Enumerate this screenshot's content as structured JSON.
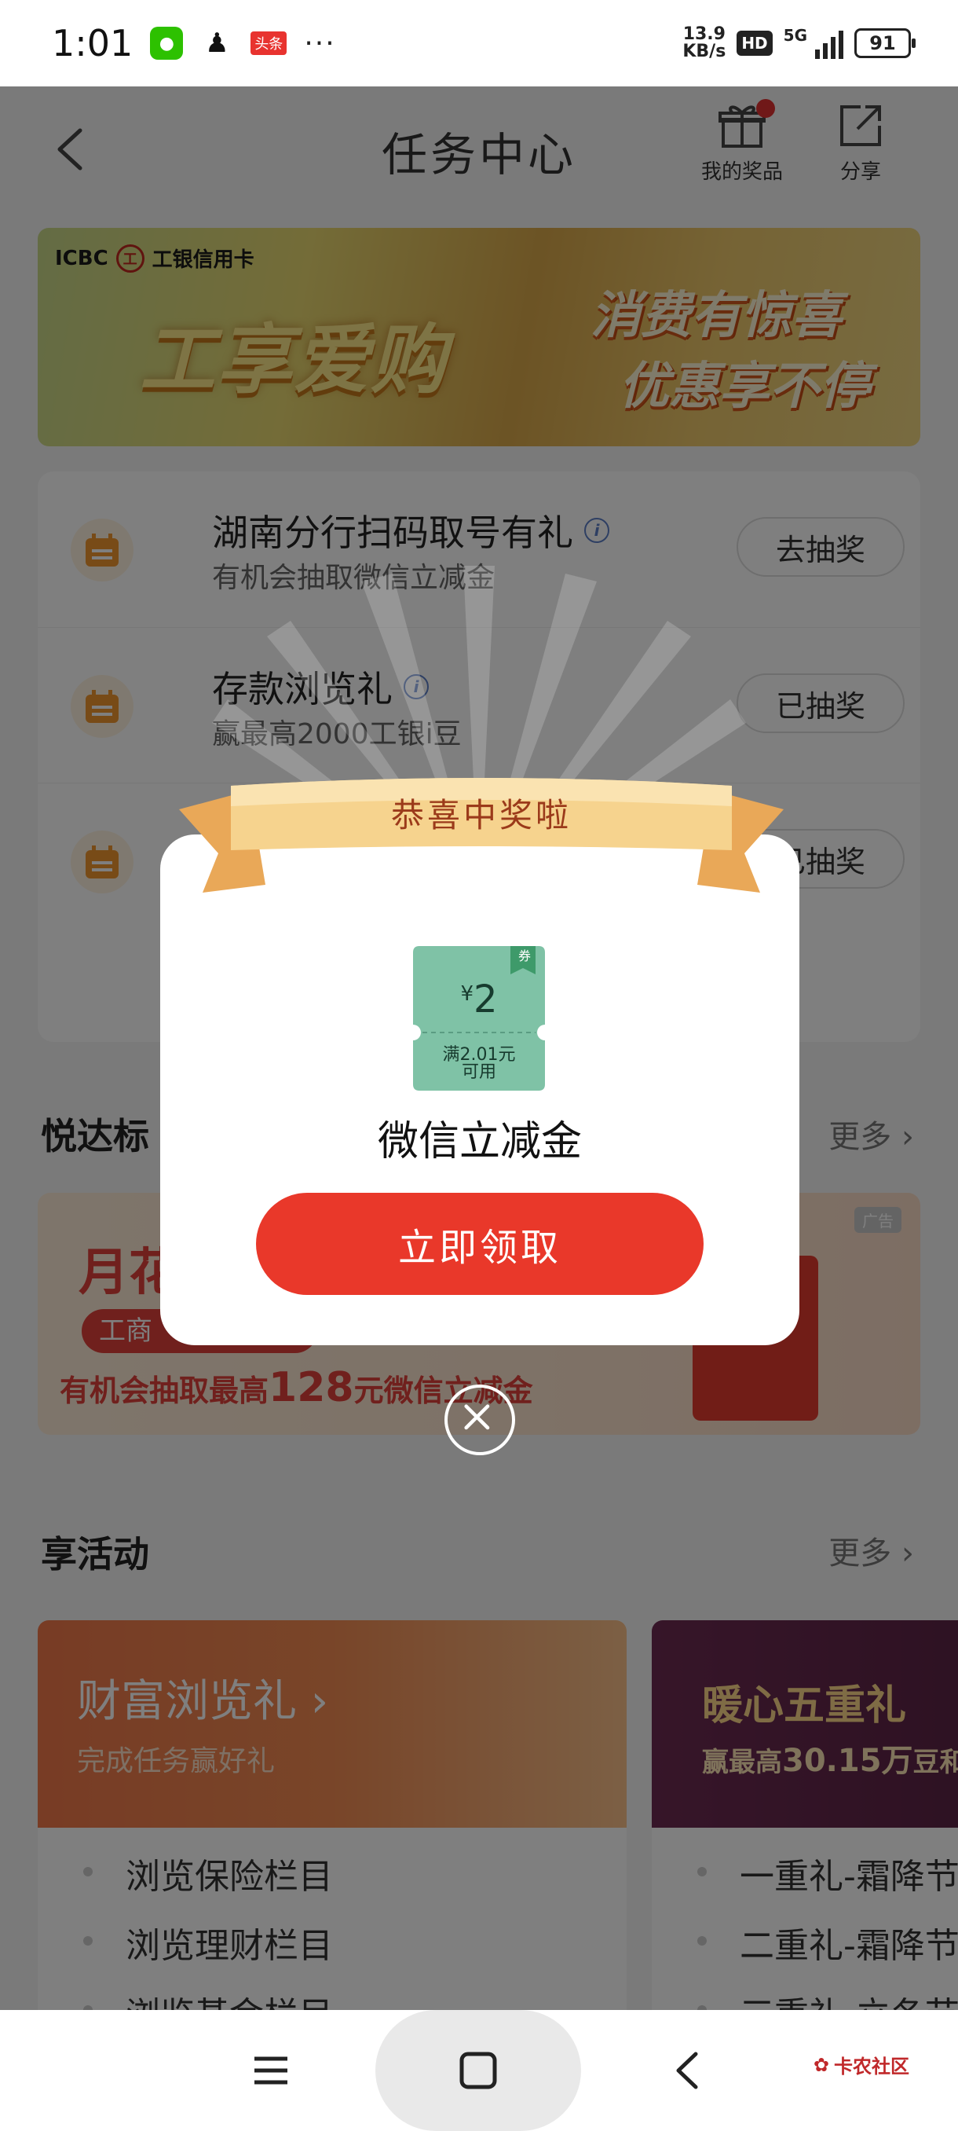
{
  "status_bar": {
    "time": "1:01",
    "toutiao": "头条",
    "more": "···",
    "speed_value": "13.9",
    "speed_unit": "KB/s",
    "hd": "HD",
    "network": "5G",
    "battery": "91"
  },
  "header": {
    "title": "任务中心",
    "prize_label": "我的奖品",
    "share_label": "分享"
  },
  "banner": {
    "brand": "ICBC",
    "brand_sub": "工银信用卡",
    "headline": "工享爱购",
    "slogan_1": "消费有惊喜",
    "slogan_2": "优惠享不停"
  },
  "tasks": [
    {
      "title": "湖南分行扫码取号有礼",
      "desc": "有机会抽取微信立减金",
      "button": "去抽奖"
    },
    {
      "title": "存款浏览礼",
      "desc": "赢最高2000工银i豆",
      "button": "已抽奖"
    },
    {
      "title": "",
      "desc": "",
      "button": "已抽奖"
    }
  ],
  "section_yueda": {
    "title": "悦达标",
    "more": "更多"
  },
  "ad": {
    "title": "月花",
    "pill": "工商",
    "line_prefix": "有机会抽取最高",
    "line_amount": "128",
    "line_suffix": "元微信立减金",
    "tag": "广告"
  },
  "section_activities": {
    "title": "享活动",
    "more": "更多"
  },
  "activities": [
    {
      "title": "财富浏览礼",
      "subtitle": "完成任务赢好礼",
      "items": [
        "浏览保险栏目",
        "浏览理财栏目",
        "浏览基金栏目"
      ]
    },
    {
      "title": "暖心五重礼",
      "subtitle_prefix": "赢最高",
      "subtitle_amount": "30.15万",
      "subtitle_suffix": "豆和限",
      "items": [
        "一重礼-霜降节",
        "二重礼-霜降节",
        "三重礼-立冬节"
      ]
    }
  ],
  "modal": {
    "ribbon_title": "恭喜中奖啦",
    "coupon_currency": "¥",
    "coupon_amount": "2",
    "coupon_tag": "券",
    "coupon_cond_1": "满2.01元",
    "coupon_cond_2": "可用",
    "prize_name": "微信立减金",
    "claim_button": "立即领取"
  },
  "watermark": "卡农社区",
  "colors": {
    "accent_red": "#e9382a",
    "coupon_green": "#7fc2a6",
    "ribbon_gold": "#f5c97a"
  }
}
